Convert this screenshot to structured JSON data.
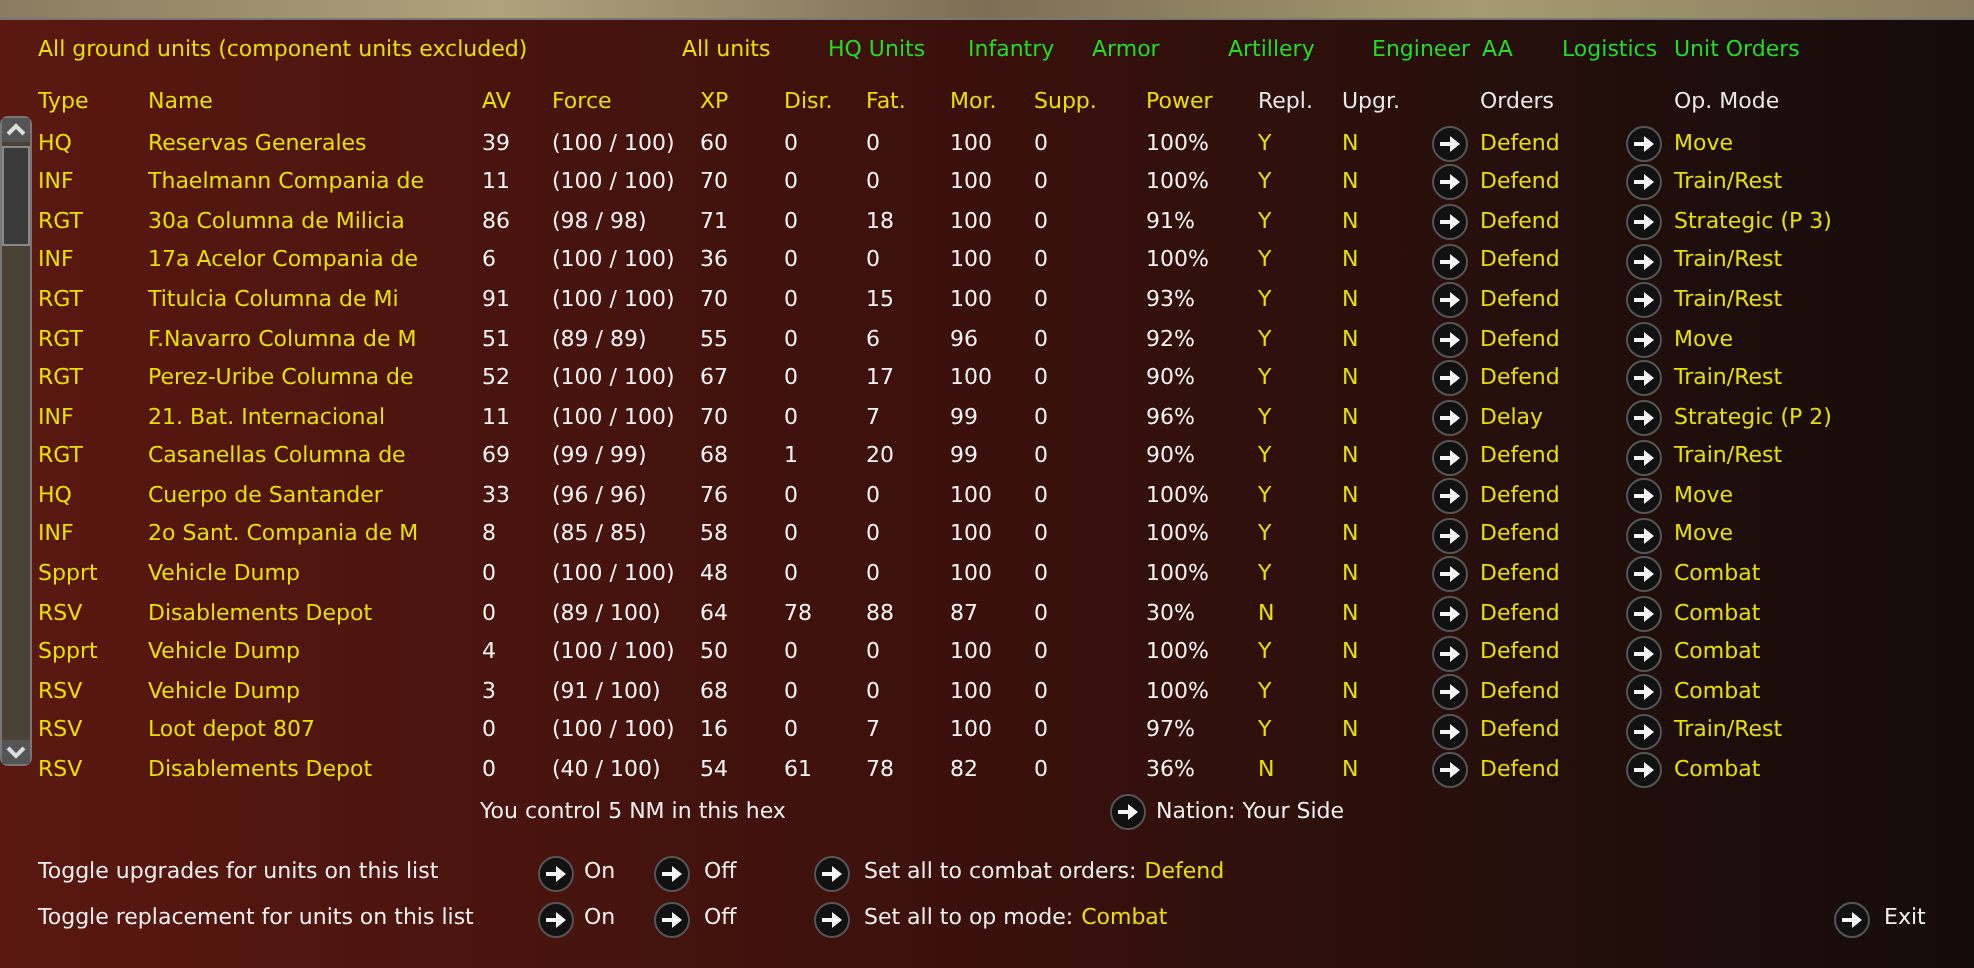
{
  "title": "All ground units (component units excluded)",
  "filters": [
    {
      "label": "All units",
      "selected": true
    },
    {
      "label": "HQ Units",
      "selected": false
    },
    {
      "label": "Infantry",
      "selected": false
    },
    {
      "label": "Armor",
      "selected": false
    },
    {
      "label": "Artillery",
      "selected": false
    },
    {
      "label": "Engineer",
      "selected": false
    },
    {
      "label": "AA",
      "selected": false
    },
    {
      "label": "Logistics",
      "selected": false
    },
    {
      "label": "Unit Orders",
      "selected": false
    }
  ],
  "columns": [
    "Type",
    "Name",
    "AV",
    "Force",
    "XP",
    "Disr.",
    "Fat.",
    "Mor.",
    "Supp.",
    "Power",
    "Repl.",
    "Upgr.",
    "Orders",
    "Op. Mode"
  ],
  "rows": [
    [
      "HQ",
      "Reservas Generales",
      "39",
      "(100 / 100)",
      "60",
      "0",
      "0",
      "100",
      "0",
      "100%",
      "Y",
      "N",
      "Defend",
      "Move"
    ],
    [
      "INF",
      "Thaelmann Compania de",
      "11",
      "(100 / 100)",
      "70",
      "0",
      "0",
      "100",
      "0",
      "100%",
      "Y",
      "N",
      "Defend",
      "Train/Rest"
    ],
    [
      "RGT",
      "30a Columna de Milicia",
      "86",
      "(98 / 98)",
      "71",
      "0",
      "18",
      "100",
      "0",
      "91%",
      "Y",
      "N",
      "Defend",
      "Strategic (P 3)"
    ],
    [
      "INF",
      "17a Acelor Compania de",
      "6",
      "(100 / 100)",
      "36",
      "0",
      "0",
      "100",
      "0",
      "100%",
      "Y",
      "N",
      "Defend",
      "Train/Rest"
    ],
    [
      "RGT",
      "Titulcia Columna de Mi",
      "91",
      "(100 / 100)",
      "70",
      "0",
      "15",
      "100",
      "0",
      "93%",
      "Y",
      "N",
      "Defend",
      "Train/Rest"
    ],
    [
      "RGT",
      "F.Navarro Columna de M",
      "51",
      "(89 / 89)",
      "55",
      "0",
      "6",
      "96",
      "0",
      "92%",
      "Y",
      "N",
      "Defend",
      "Move"
    ],
    [
      "RGT",
      "Perez-Uribe Columna de",
      "52",
      "(100 / 100)",
      "67",
      "0",
      "17",
      "100",
      "0",
      "90%",
      "Y",
      "N",
      "Defend",
      "Train/Rest"
    ],
    [
      "INF",
      "21. Bat. Internacional",
      "11",
      "(100 / 100)",
      "70",
      "0",
      "7",
      "99",
      "0",
      "96%",
      "Y",
      "N",
      "Delay",
      "Strategic (P 2)"
    ],
    [
      "RGT",
      "Casanellas Columna de",
      "69",
      "(99 / 99)",
      "68",
      "1",
      "20",
      "99",
      "0",
      "90%",
      "Y",
      "N",
      "Defend",
      "Train/Rest"
    ],
    [
      "HQ",
      "Cuerpo de Santander",
      "33",
      "(96 / 96)",
      "76",
      "0",
      "0",
      "100",
      "0",
      "100%",
      "Y",
      "N",
      "Defend",
      "Move"
    ],
    [
      "INF",
      "2o Sant. Compania de M",
      "8",
      "(85 / 85)",
      "58",
      "0",
      "0",
      "100",
      "0",
      "100%",
      "Y",
      "N",
      "Defend",
      "Move"
    ],
    [
      "Spprt",
      "Vehicle Dump",
      "0",
      "(100 / 100)",
      "48",
      "0",
      "0",
      "100",
      "0",
      "100%",
      "Y",
      "N",
      "Defend",
      "Combat"
    ],
    [
      "RSV",
      "Disablements Depot",
      "0",
      "(89 / 100)",
      "64",
      "78",
      "88",
      "87",
      "0",
      "30%",
      "N",
      "N",
      "Defend",
      "Combat"
    ],
    [
      "Spprt",
      "Vehicle Dump",
      "4",
      "(100 / 100)",
      "50",
      "0",
      "0",
      "100",
      "0",
      "100%",
      "Y",
      "N",
      "Defend",
      "Combat"
    ],
    [
      "RSV",
      "Vehicle Dump",
      "3",
      "(91 / 100)",
      "68",
      "0",
      "0",
      "100",
      "0",
      "100%",
      "Y",
      "N",
      "Defend",
      "Combat"
    ],
    [
      "RSV",
      "Loot depot 807",
      "0",
      "(100 / 100)",
      "16",
      "0",
      "7",
      "100",
      "0",
      "97%",
      "Y",
      "N",
      "Defend",
      "Train/Rest"
    ],
    [
      "RSV",
      "Disablements Depot",
      "0",
      "(40 / 100)",
      "54",
      "61",
      "78",
      "82",
      "0",
      "36%",
      "N",
      "N",
      "Defend",
      "Combat"
    ]
  ],
  "hex_info": "You control 5 NM in this hex",
  "nation": "Nation: Your Side",
  "toggles": [
    {
      "label": "Toggle upgrades for units on this list",
      "on": "On",
      "off": "Off"
    },
    {
      "label": "Toggle replacement for units on this list",
      "on": "On",
      "off": "Off"
    }
  ],
  "set_all": [
    {
      "label": "Set all to combat orders:",
      "value": "Defend"
    },
    {
      "label": "Set all to op mode:",
      "value": "Combat"
    }
  ],
  "exit": "Exit"
}
